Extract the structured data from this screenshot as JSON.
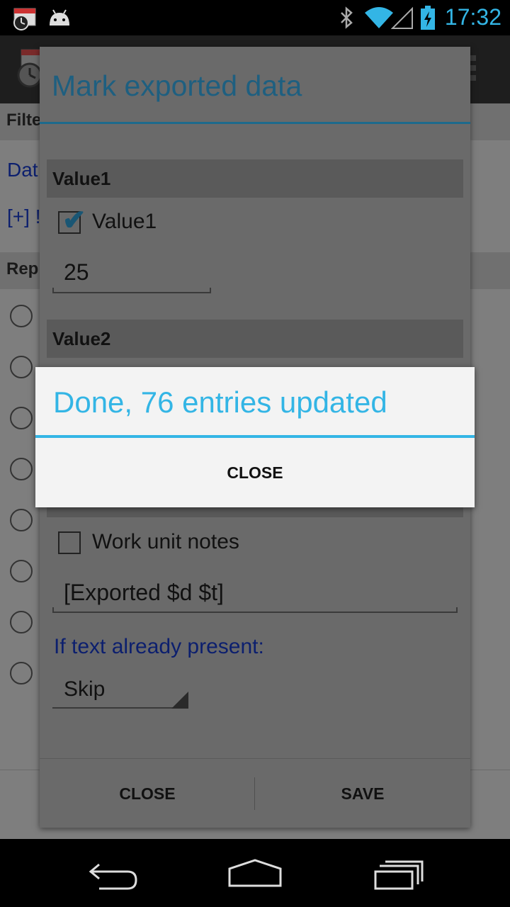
{
  "status_bar": {
    "time": "17:32",
    "icons": [
      "calendar-clock-icon",
      "android-icon",
      "bluetooth-icon",
      "wifi-icon",
      "signal-icon",
      "battery-charging-icon"
    ]
  },
  "background_app": {
    "filter_section": "Filte",
    "date_link": "Dat",
    "add_link": "[+] !",
    "report_section": "Rep"
  },
  "dialog": {
    "title": "Mark exported data",
    "value1_section": "Value1",
    "value1_checkbox_label": "Value1",
    "value1_checked": true,
    "value1_input": "25",
    "value2_section": "Value2",
    "notes_checkbox_label": "Work unit notes",
    "notes_checked": false,
    "notes_input": "[Exported $d $t]",
    "if_text_present_label": "If text already present:",
    "spinner_selected": "Skip",
    "close_button": "CLOSE",
    "save_button": "SAVE"
  },
  "alert": {
    "title": "Done, 76 entries updated",
    "close_button": "CLOSE"
  },
  "nav_bar": {
    "icons": [
      "back-icon",
      "home-icon",
      "recent-apps-icon"
    ]
  },
  "colors": {
    "accent": "#33b5e5",
    "dialog_title": "#1e5f80"
  }
}
